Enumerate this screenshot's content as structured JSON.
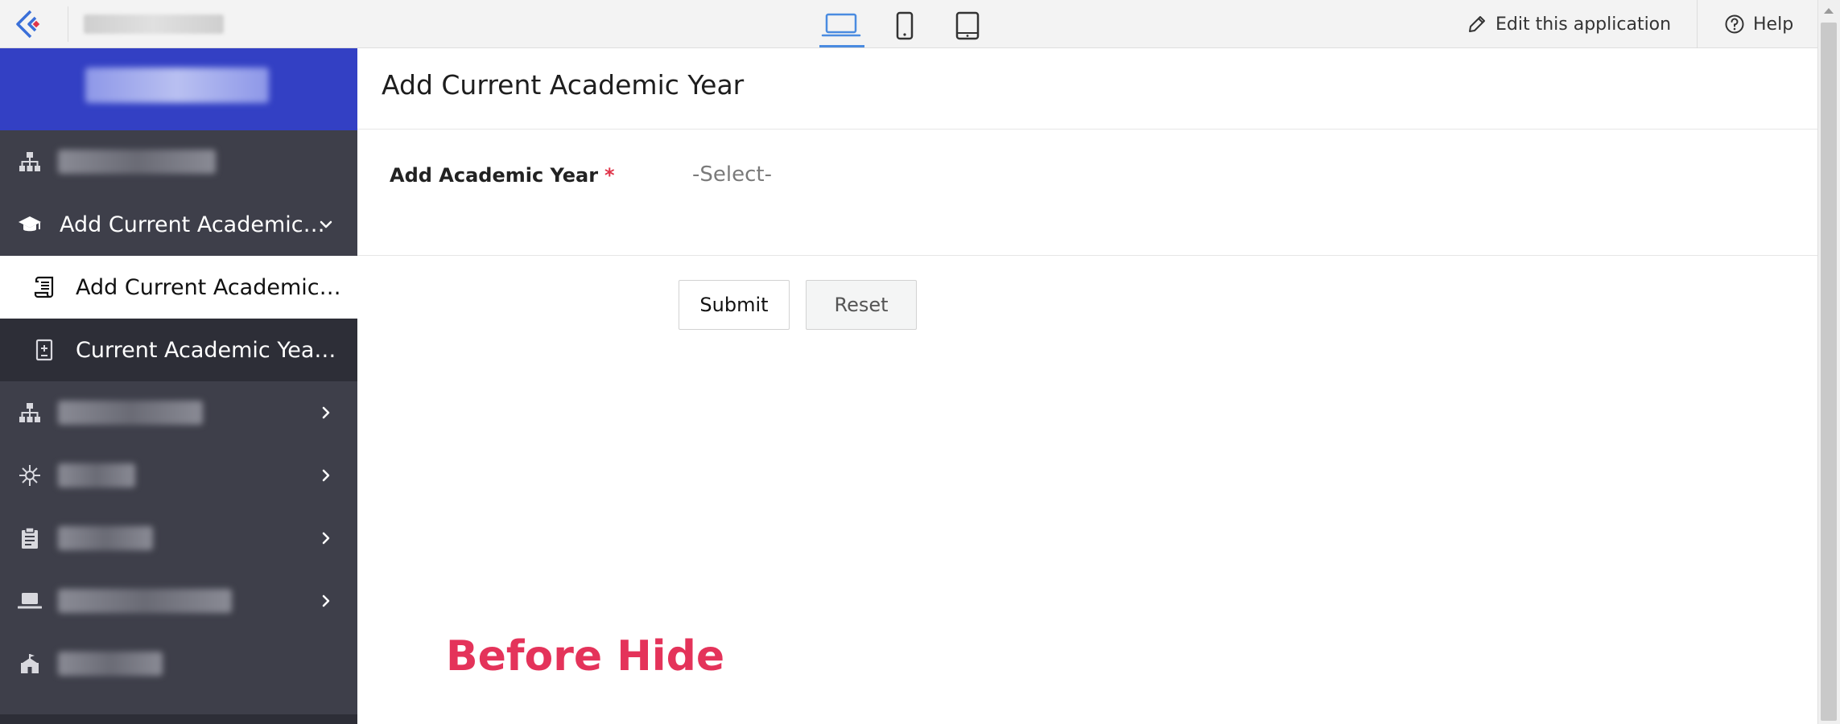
{
  "topbar": {
    "edit_label": "Edit this application",
    "help_label": "Help",
    "device_modes": [
      "desktop",
      "phone",
      "tablet"
    ],
    "active_device": "desktop"
  },
  "sidebar": {
    "items": [
      {
        "label": "",
        "icon": "sitemap-icon",
        "blurred": true
      },
      {
        "label": "Add Current Academic…",
        "icon": "graduation-cap-icon",
        "expanded": true
      },
      {
        "label": "Add Current Academic…",
        "icon": "scroll-icon",
        "active": true
      },
      {
        "label": "Current Academic Yea…",
        "icon": "report-icon"
      },
      {
        "label": "",
        "icon": "org-chart-icon",
        "blurred": true
      },
      {
        "label": "",
        "icon": "network-icon",
        "blurred": true
      },
      {
        "label": "",
        "icon": "clipboard-icon",
        "blurred": true
      },
      {
        "label": "",
        "icon": "laptop-icon",
        "blurred": true
      },
      {
        "label": "",
        "icon": "school-icon",
        "blurred": true
      }
    ]
  },
  "main": {
    "title": "Add Current Academic Year",
    "field_label": "Add Academic Year",
    "required_mark": "*",
    "select_placeholder": "-Select-",
    "submit_label": "Submit",
    "reset_label": "Reset",
    "caption": "Before Hide"
  },
  "colors": {
    "sidebar_bg": "#3e3f4a",
    "brand_bg": "#3340c4",
    "accent": "#4a8be0",
    "caption": "#e4335a",
    "required": "#e0354a"
  }
}
